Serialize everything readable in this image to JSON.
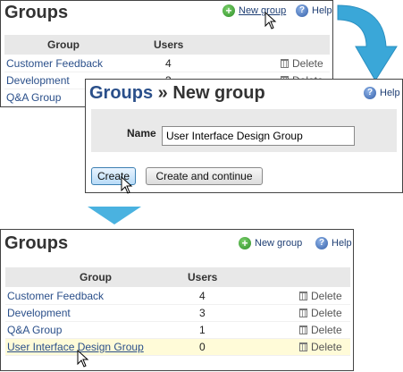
{
  "colors": {
    "accent_blue": "#4ab2e0",
    "link": "#2a4f8a",
    "highlight_row": "#fffbd8"
  },
  "top_panel": {
    "title": "Groups",
    "new_group_label": "New group",
    "help_label": "Help",
    "columns": [
      "Group",
      "Users"
    ],
    "rows": [
      {
        "name": "Customer Feedback",
        "users": "4",
        "delete": "Delete"
      },
      {
        "name": "Development",
        "users": "3",
        "delete": "Delete"
      },
      {
        "name": "Q&A Group",
        "users": "",
        "delete": ""
      }
    ]
  },
  "dialog": {
    "title_main": "Groups",
    "title_sep": " » ",
    "title_sub": "New group",
    "help_label": "Help",
    "name_label": "Name",
    "name_value": "User Interface Design Group",
    "create_label": "Create",
    "create_continue_label": "Create and continue"
  },
  "bottom_panel": {
    "title": "Groups",
    "new_group_label": "New group",
    "help_label": "Help",
    "columns": [
      "Group",
      "Users"
    ],
    "rows": [
      {
        "name": "Customer Feedback",
        "users": "4",
        "delete": "Delete"
      },
      {
        "name": "Development",
        "users": "3",
        "delete": "Delete"
      },
      {
        "name": "Q&A Group",
        "users": "1",
        "delete": "Delete"
      },
      {
        "name": "User Interface Design Group",
        "users": "0",
        "delete": "Delete"
      }
    ]
  }
}
